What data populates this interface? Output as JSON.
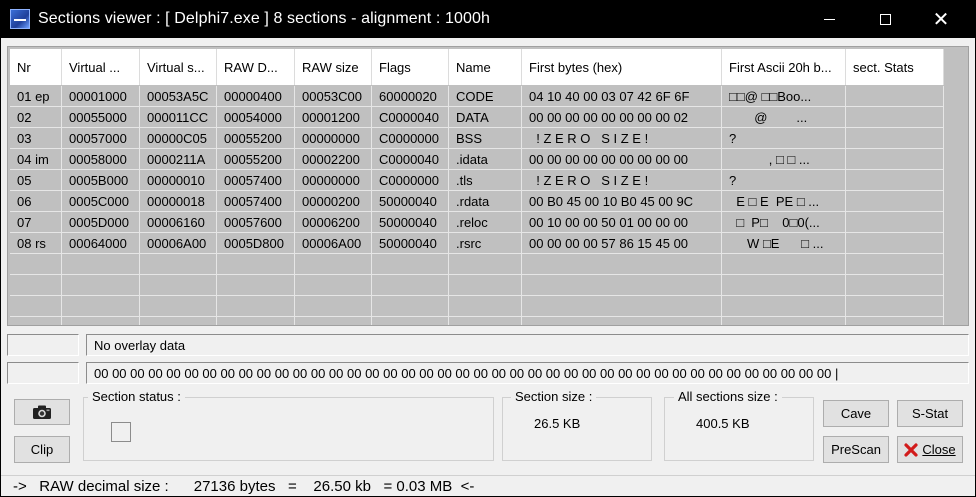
{
  "window": {
    "title": "Sections viewer :  [ Delphi7.exe ] 8 sections - alignment : 1000h",
    "close_glyph": "✕"
  },
  "grid": {
    "columns": [
      "Nr",
      "Virtual ...",
      "Virtual s...",
      "RAW D...",
      "RAW size",
      "Flags",
      "Name",
      "First bytes (hex)",
      "First Ascii 20h b...",
      "sect. Stats"
    ],
    "rows": [
      [
        "01 ep",
        "00001000",
        "00053A5C",
        "00000400",
        "00053C00",
        "60000020",
        "CODE",
        "04 10 40 00 03 07 42 6F 6F",
        "□□@ □□Boo...",
        ""
      ],
      [
        "02",
        "00055000",
        "000011CC",
        "00054000",
        "00001200",
        "C0000040",
        "DATA",
        "00 00 00 00 00 00 00 00 02",
        "       @        ...",
        ""
      ],
      [
        "03",
        "00057000",
        "00000C05",
        "00055200",
        "00000000",
        "C0000000",
        "BSS",
        "  ! Z E R O   S I Z E !",
        "?",
        ""
      ],
      [
        "04 im",
        "00058000",
        "0000211A",
        "00055200",
        "00002200",
        "C0000040",
        ".idata",
        "00 00 00 00 00 00 00 00 00",
        "           , □ □ ...",
        ""
      ],
      [
        "05",
        "0005B000",
        "00000010",
        "00057400",
        "00000000",
        "C0000000",
        ".tls",
        "  ! Z E R O   S I Z E !",
        "?",
        ""
      ],
      [
        "06",
        "0005C000",
        "00000018",
        "00057400",
        "00000200",
        "50000040",
        ".rdata",
        "00 B0 45 00 10 B0 45 00 9C",
        "  E □ E  PE □ ...",
        ""
      ],
      [
        "07",
        "0005D000",
        "00006160",
        "00057600",
        "00006200",
        "50000040",
        ".reloc",
        "00 10 00 00 50 01 00 00 00",
        "  □  P□    0□0(...",
        ""
      ],
      [
        "08 rs",
        "00064000",
        "00006A00",
        "0005D800",
        "00006A00",
        "50000040",
        ".rsrc",
        "00 00 00 00 57 86 15 45 00",
        "     W □E      □ ...",
        ""
      ]
    ],
    "empty_rows": 4
  },
  "overlay": {
    "info": "No overlay data",
    "hex": "00 00 00 00 00 00 00 00 00 00 00 00 00 00 00 00 00 00 00 00 00 00 00 00 00 00 00 00 00 00 00 00 00 00 00 00 00 00 00 00 00   |"
  },
  "buttons": {
    "clip": "Clip",
    "cave": "Cave",
    "sstat": "S-Stat",
    "prescan": "PreScan",
    "close": "Close"
  },
  "section_status": {
    "label": "Section status :"
  },
  "section_size": {
    "label": "Section size :",
    "value": "26.5 KB"
  },
  "all_sections_size": {
    "label": "All sections size :",
    "value": "400.5 KB"
  },
  "status_bar": {
    "text": "->   RAW decimal size :      27136 bytes   =    26.50 kb   = 0.03 MB  <-"
  }
}
